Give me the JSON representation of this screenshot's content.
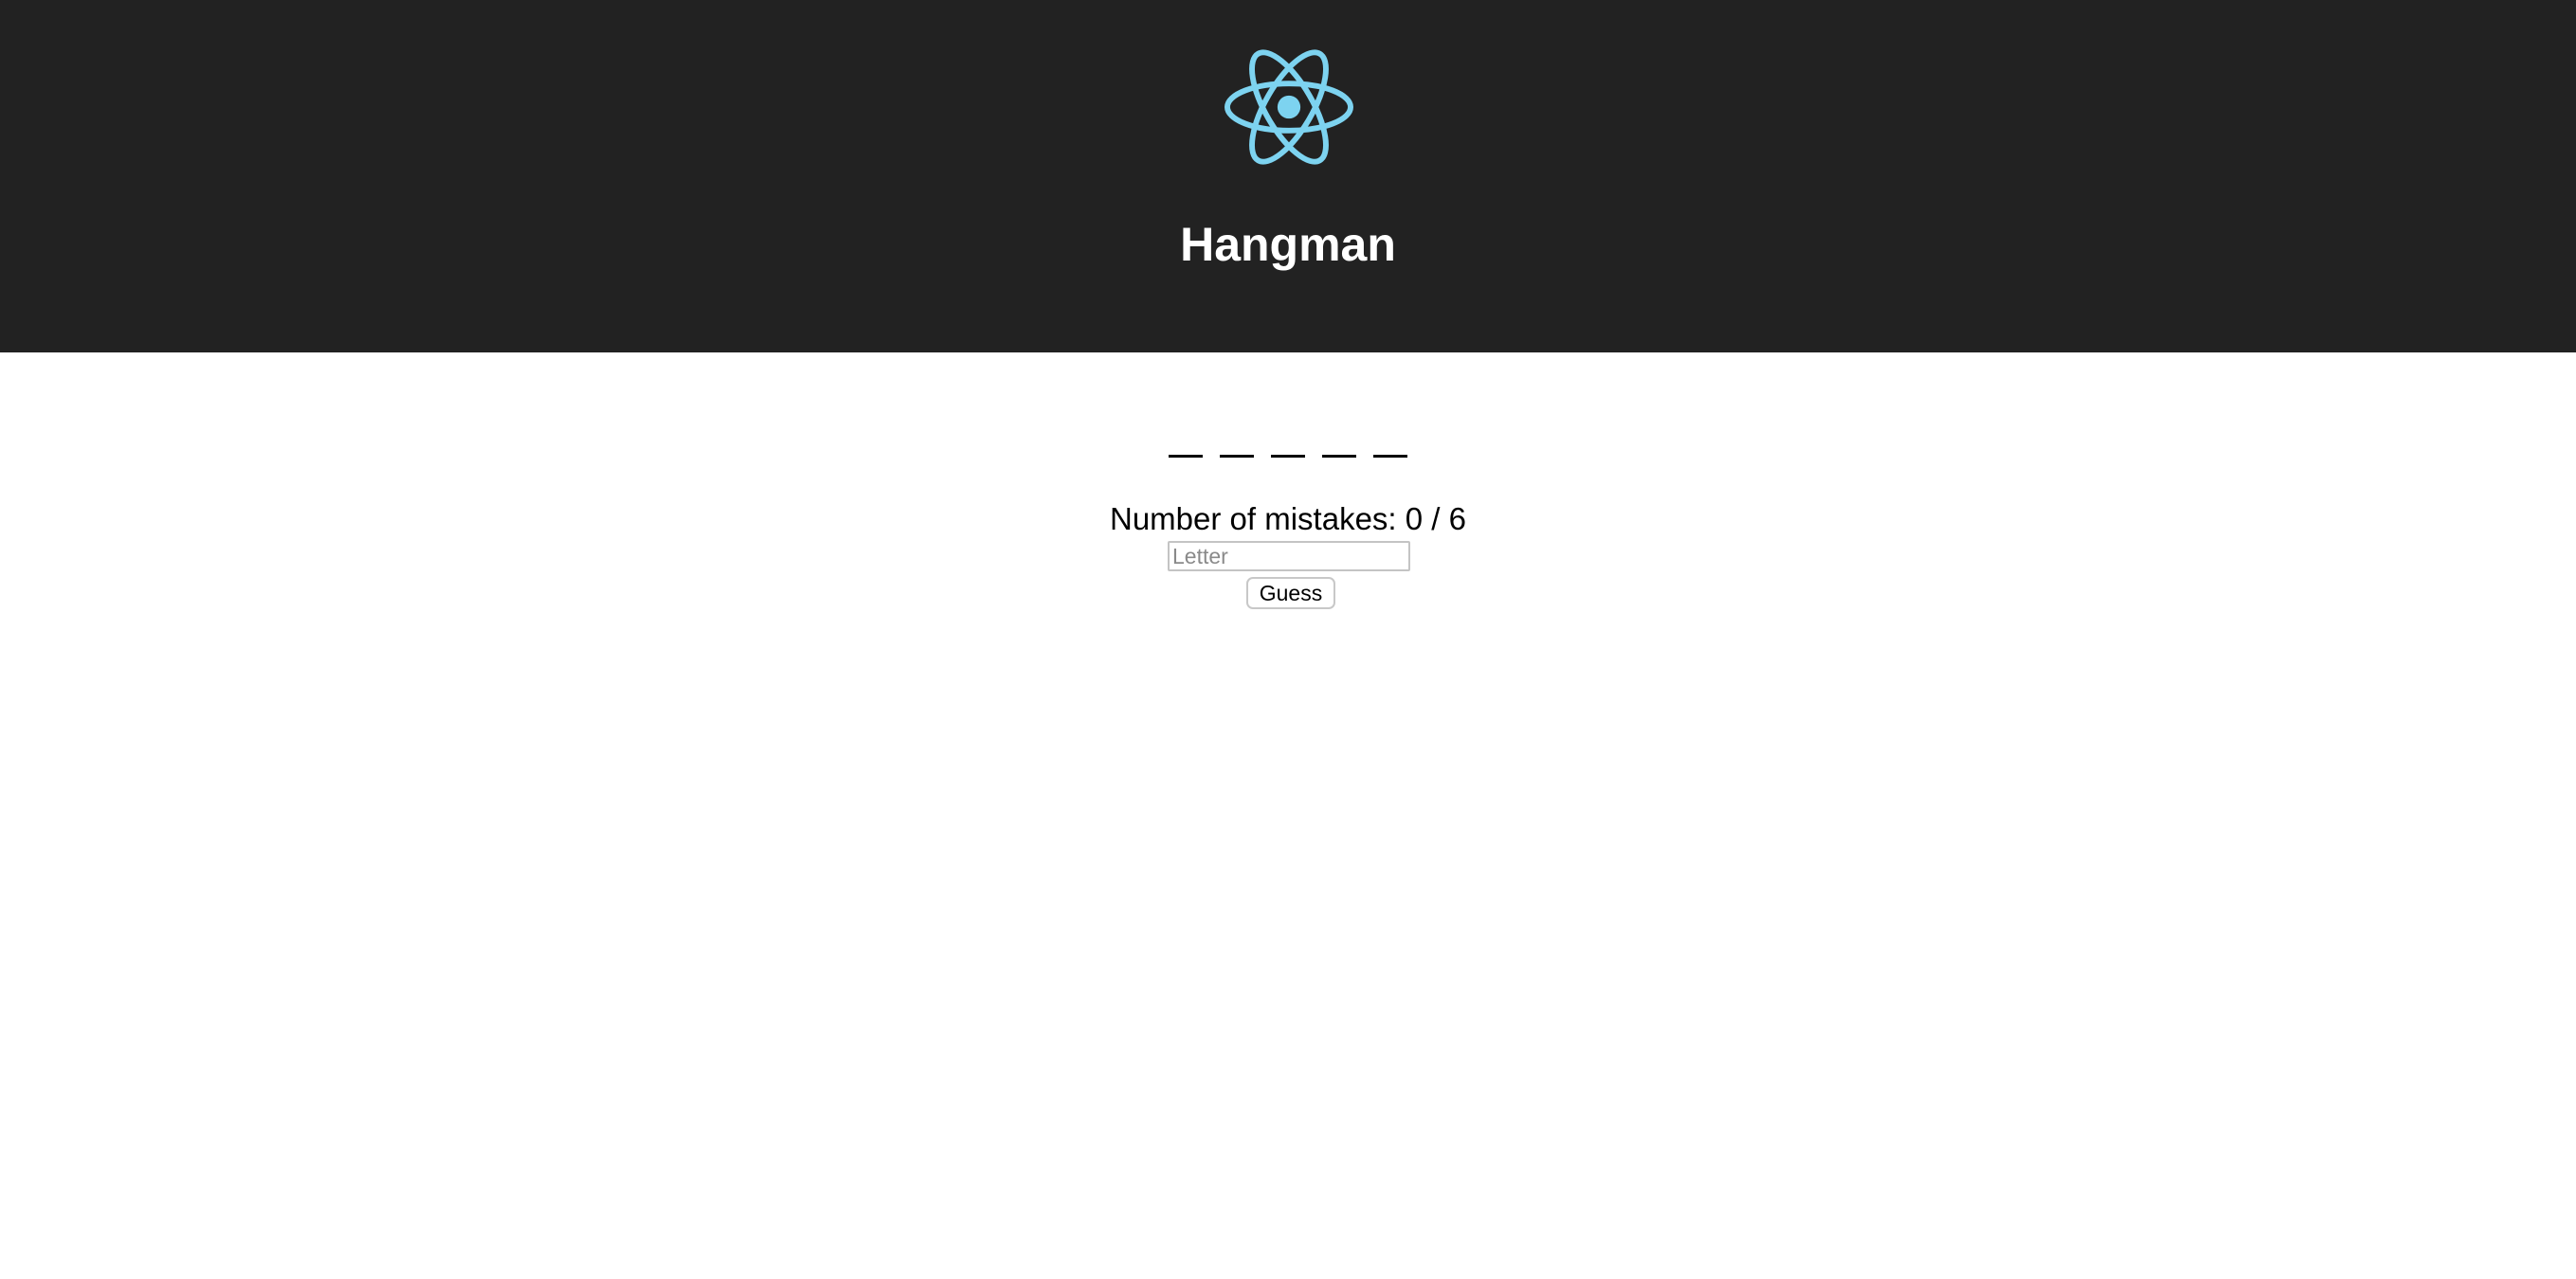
{
  "header": {
    "logo_icon": "react-atom-icon",
    "logo_color": "#7dd3f0",
    "background_color": "#222222",
    "title": "Hangman"
  },
  "game": {
    "word_slots": [
      "",
      "",
      "",
      "",
      ""
    ],
    "mistakes_text": "Number of mistakes: 0 / 6",
    "mistakes": 0,
    "max_mistakes": 6,
    "input_value": "",
    "input_placeholder": "Letter",
    "guess_label": "Guess"
  }
}
